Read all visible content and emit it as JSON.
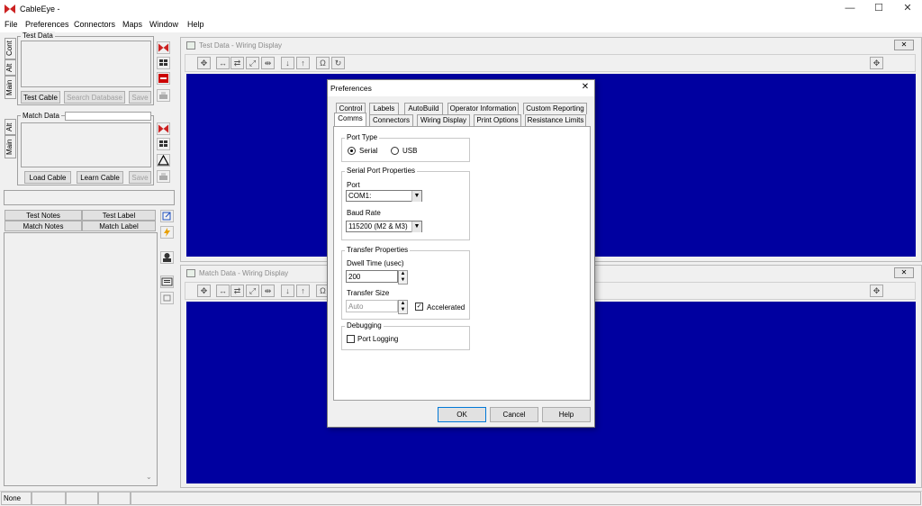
{
  "window": {
    "title": "CableEye -",
    "minimize": "—",
    "maximize": "☐",
    "close": "✕"
  },
  "menu": [
    "File",
    "Preferences",
    "Connectors",
    "Maps",
    "Window",
    "Help"
  ],
  "left": {
    "test_data": {
      "label": "Test Data",
      "tabs": [
        "Cont",
        "Alt",
        "Main"
      ],
      "buttons": {
        "test_cable": "Test Cable",
        "search_db": "Search Database",
        "save": "Save"
      }
    },
    "match_data": {
      "label": "Match Data",
      "tabs": [
        "Alt",
        "Main"
      ],
      "buttons": {
        "load_cable": "Load Cable",
        "learn_cable": "Learn Cable",
        "save": "Save"
      }
    },
    "notes_tabs": {
      "test_notes": "Test Notes",
      "test_label": "Test Label",
      "match_notes": "Match Notes",
      "match_label": "Match Label"
    }
  },
  "test_window": {
    "title": "Test Data - Wiring Display"
  },
  "match_window": {
    "title": "Match Data - Wiring Display"
  },
  "dialog": {
    "title": "Preferences",
    "close": "✕",
    "tabs_row1": [
      "Control",
      "Labels",
      "AutoBuild",
      "Operator Information",
      "Custom Reporting"
    ],
    "tabs_row2": [
      "Comms",
      "Connectors",
      "Wiring Display",
      "Print Options",
      "Resistance Limits"
    ],
    "port_type": {
      "label": "Port Type",
      "serial": "Serial",
      "usb": "USB"
    },
    "serial_port": {
      "label": "Serial Port Properties",
      "port_label": "Port",
      "port_value": "COM1:",
      "baud_label": "Baud Rate",
      "baud_value": "115200 (M2 & M3)"
    },
    "transfer": {
      "label": "Transfer Properties",
      "dwell_label": "Dwell Time (usec)",
      "dwell_value": "200",
      "size_label": "Transfer Size",
      "size_value": "Auto",
      "accelerated": "Accelerated",
      "check": "✓"
    },
    "debugging": {
      "label": "Debugging",
      "port_logging": "Port Logging"
    },
    "buttons": {
      "ok": "OK",
      "cancel": "Cancel",
      "help": "Help"
    }
  },
  "status": {
    "pane1": "None"
  },
  "colors": {
    "display_blue": "#0000a0",
    "brand_red": "#cc2222"
  }
}
